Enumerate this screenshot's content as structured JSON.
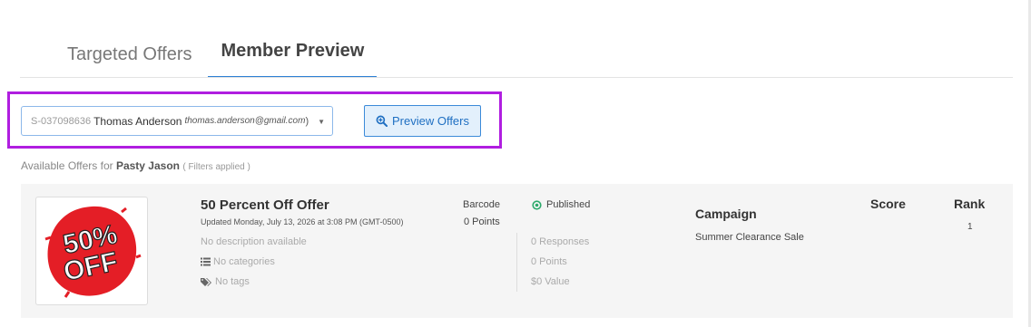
{
  "tabs": [
    {
      "label": "Targeted Offers",
      "active": false
    },
    {
      "label": "Member Preview",
      "active": true
    }
  ],
  "member_select": {
    "member_id": "S-037098636",
    "name": "Thomas Anderson",
    "email": "thomas.anderson@gmail.com",
    "suffix": ")"
  },
  "preview_button": {
    "label": "Preview Offers",
    "icon": "zoom-in-icon"
  },
  "available": {
    "prefix": "Available Offers for",
    "member": "Pasty Jason",
    "filters": "( Filters applied )"
  },
  "offer": {
    "image_text": [
      "50%",
      "OFF"
    ],
    "title": "50 Percent Off Offer",
    "updated": "Updated Monday, July 13, 2026 at 3:08 PM (GMT-0500)",
    "description": "No description available",
    "categories": "No categories",
    "tags": "No tags",
    "barcode": "Barcode",
    "points": "0 Points",
    "status": "Published",
    "responses": "0 Responses",
    "option_points": "0 Points",
    "value": "$0 Value",
    "campaign_heading": "Campaign",
    "campaign": "Summer Clearance Sale",
    "score_heading": "Score",
    "rank_heading": "Rank",
    "rank": "1"
  },
  "colors": {
    "accent": "#2b7fd4",
    "highlight_outline": "#b01ee0",
    "published_green": "#2ca96b",
    "badge_red": "#e41e26"
  }
}
